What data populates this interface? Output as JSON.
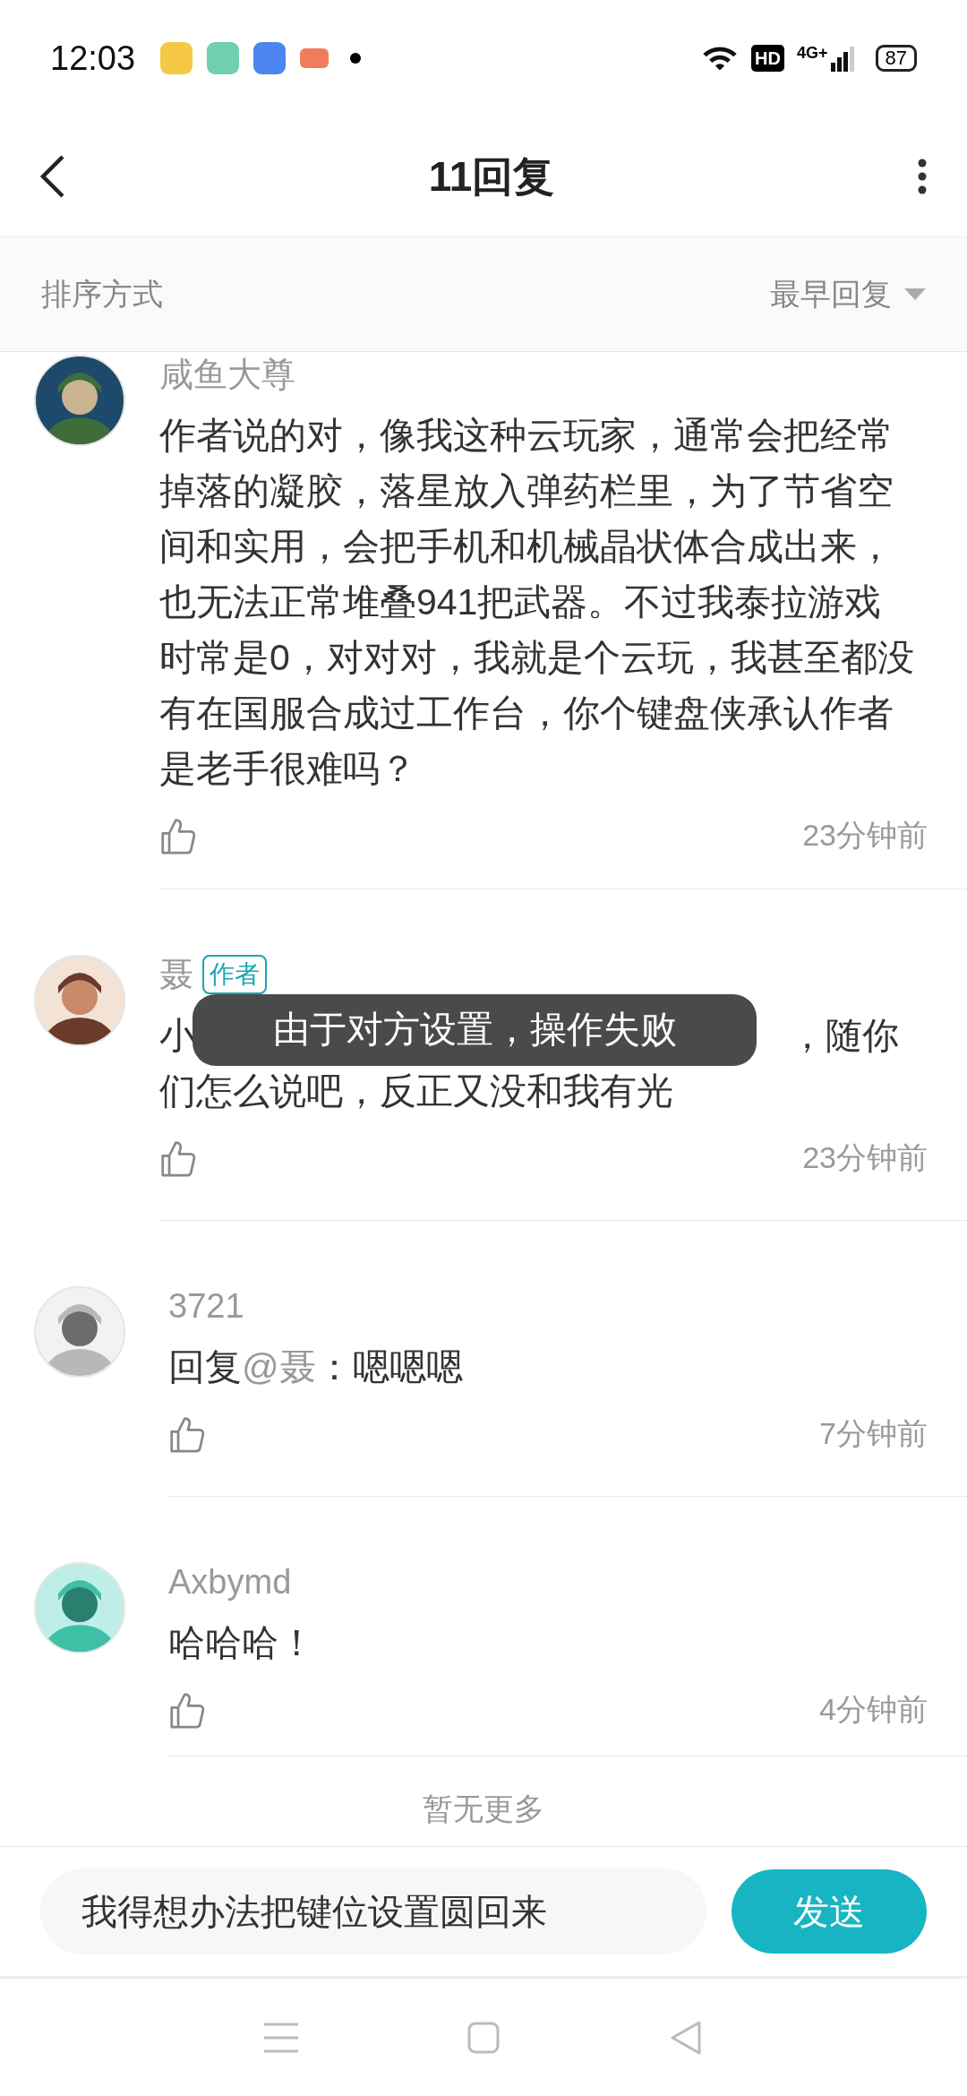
{
  "status_bar": {
    "time": "12:03",
    "battery": "87",
    "network": "4G+",
    "hd": "HD"
  },
  "header": {
    "title": "11回复"
  },
  "sort_bar": {
    "label": "排序方式",
    "value": "最早回复"
  },
  "comments": [
    {
      "name": "咸鱼大尊",
      "body": [
        {
          "text": "作者说的对，像我这种云玩家，通常会把经常掉落的凝胶，落星放入弹药栏里，为了节省空间和实用，会把手机和机械晶状体合成出来，也无法正常堆叠941把武器。不过我泰拉游戏时常是0，对对对，我就是个云玩，我甚至都没有在国服合成过工作台，你个键盘侠承认作者是老手很难吗？"
        }
      ],
      "time": "23分钟前"
    },
    {
      "name": "聂",
      "badge": "作者",
      "body": [
        {
          "text": "小",
          "kind": "partial_left"
        },
        {
          "text": "，随你",
          "kind": "partial_right"
        },
        {
          "text": "们怎么说吧，反正又没和我有光"
        }
      ],
      "time": "23分钟前"
    },
    {
      "name": "3721",
      "body": [
        {
          "text": "回复"
        },
        {
          "text": "@聂",
          "kind": "mention"
        },
        {
          "text": "：嗯嗯嗯"
        }
      ],
      "time": "7分钟前"
    },
    {
      "name": "Axbymd",
      "body": [
        {
          "text": "哈哈哈！"
        }
      ],
      "time": "4分钟前"
    }
  ],
  "end_note": "暂无更多",
  "toast": "由于对方设置，操作失败",
  "input": {
    "value": "我得想办法把键位设置圆回来",
    "send": "发送"
  }
}
